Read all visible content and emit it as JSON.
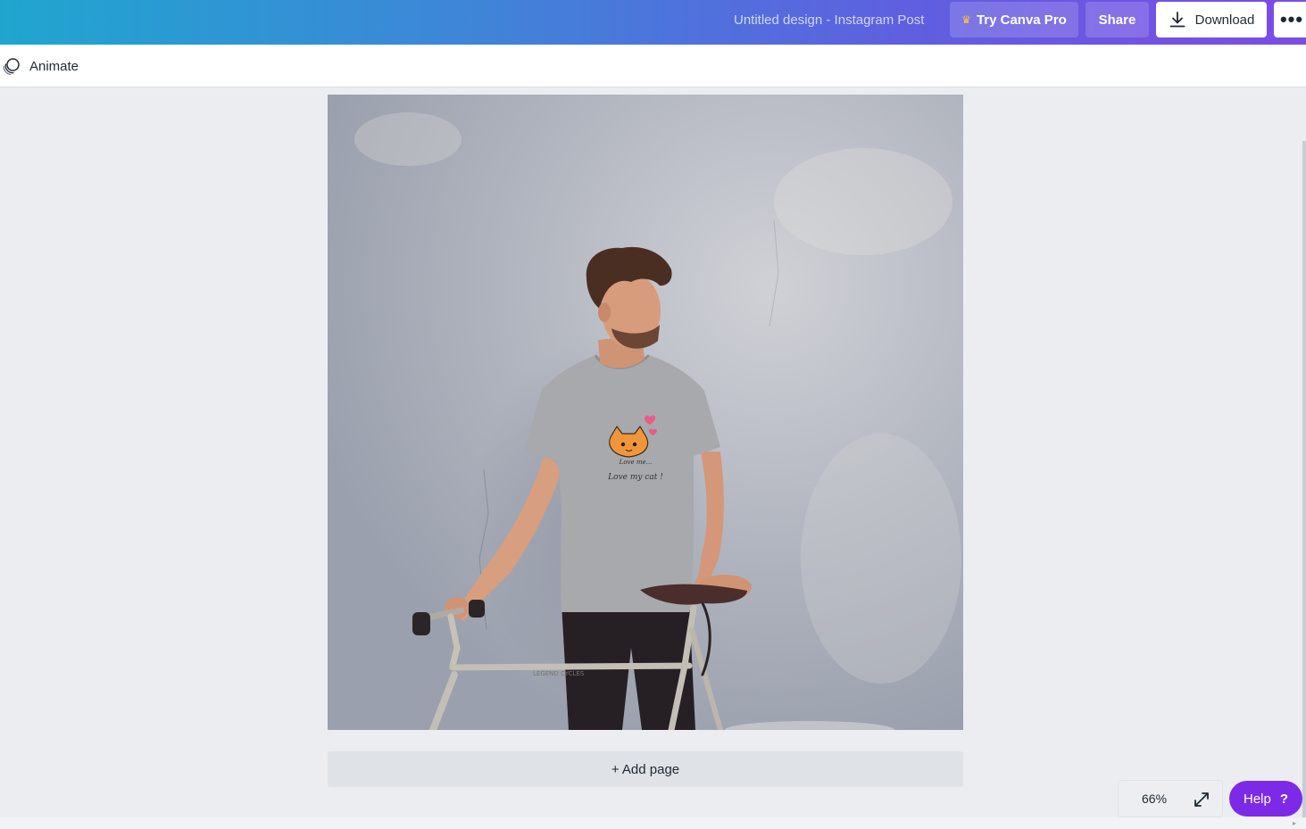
{
  "header": {
    "doc_title": "Untitled design - Instagram Post",
    "pro_label": "Try Canva Pro",
    "share_label": "Share",
    "download_label": "Download",
    "more_label": "•••"
  },
  "toolbar": {
    "animate_label": "Animate"
  },
  "canvas": {
    "shirt_text_line1": "Love me...",
    "shirt_text_line2": "Love my cat !",
    "bike_text": "LEGEND CYCLES"
  },
  "add_page_label": "+ Add page",
  "zoom": {
    "value": "66%"
  },
  "help": {
    "label": "Help",
    "icon": "?"
  },
  "colors": {
    "help_purple": "#7d2ae8",
    "header_gradient_start": "#1fa6cf",
    "header_gradient_end": "#7d4ce6"
  }
}
